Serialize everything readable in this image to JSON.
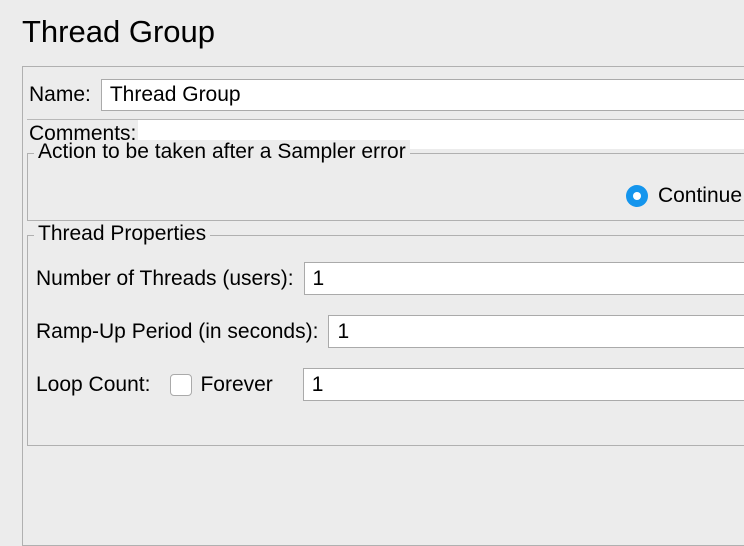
{
  "title": "Thread Group",
  "nameField": {
    "label": "Name:",
    "value": "Thread Group"
  },
  "commentsField": {
    "label": "Comments:",
    "value": ""
  },
  "actionSection": {
    "legend": "Action to be taken after a Sampler error",
    "continueOption": {
      "label": "Continue",
      "selected": true
    }
  },
  "threadProps": {
    "legend": "Thread Properties",
    "numThreads": {
      "label": "Number of Threads (users):",
      "value": "1"
    },
    "rampUp": {
      "label": "Ramp-Up Period (in seconds):",
      "value": "1"
    },
    "loopCount": {
      "label": "Loop Count:",
      "foreverLabel": "Forever",
      "foreverChecked": false,
      "value": "1"
    }
  }
}
